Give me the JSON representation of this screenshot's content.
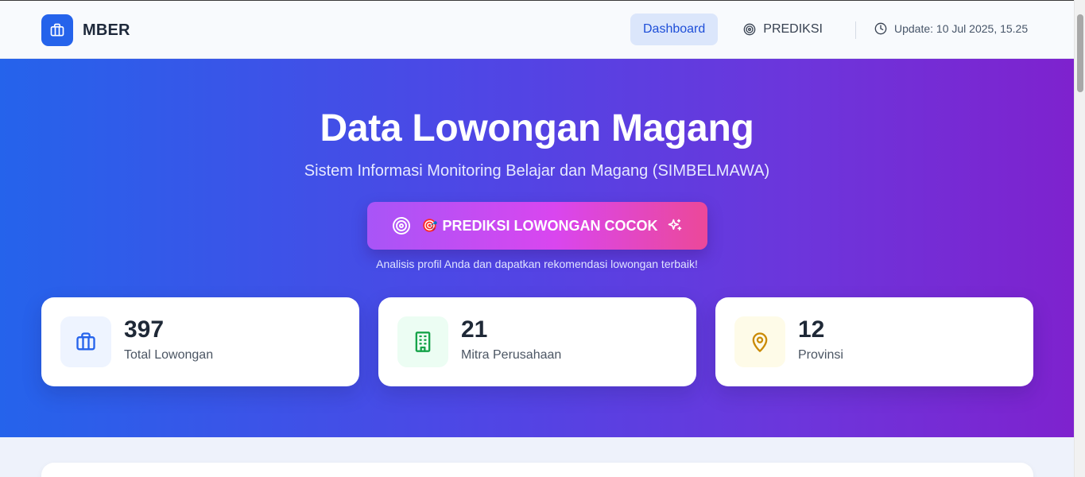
{
  "brand": {
    "name": "MBER",
    "icon": "briefcase-icon",
    "color": "#2563eb"
  },
  "nav": {
    "dashboard_label": "Dashboard",
    "prediksi_label": "PREDIKSI",
    "prediksi_icon": "target-icon",
    "update_icon": "clock-icon",
    "update_text": "Update: 10 Jul 2025, 15.25"
  },
  "hero": {
    "title": "Data Lowongan Magang",
    "subtitle": "Sistem Informasi Monitoring Belajar dan Magang (SIMBELMAWA)",
    "cta_label": "PREDIKSI LOWONGAN COCOK",
    "cta_emoji": "🎯",
    "cta_note": "Analisis profil Anda dan dapatkan rekomendasi lowongan terbaik!",
    "gradient_start": "#2563eb",
    "gradient_end": "#7e22ce"
  },
  "stats": [
    {
      "value": "397",
      "label": "Total Lowongan",
      "icon": "briefcase-icon",
      "color": "#2563eb",
      "bg": "#eef4ff"
    },
    {
      "value": "21",
      "label": "Mitra Perusahaan",
      "icon": "building-icon",
      "color": "#16a34a",
      "bg": "#ecfdf3"
    },
    {
      "value": "12",
      "label": "Provinsi",
      "icon": "map-pin-icon",
      "color": "#ca8a04",
      "bg": "#fefbe8"
    }
  ]
}
